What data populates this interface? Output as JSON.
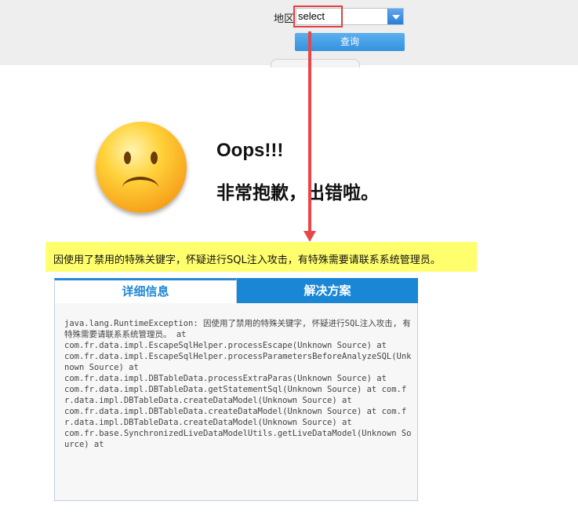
{
  "header": {
    "region_label": "地区",
    "region_select_value": "select",
    "query_button_label": "查询"
  },
  "error": {
    "title": "Oops!!!",
    "subtitle": "非常抱歉，出错啦。",
    "warning": "因使用了禁用的特殊关键字，怀疑进行SQL注入攻击，有特殊需要请联系系统管理员。"
  },
  "tabs": [
    {
      "label": "详细信息"
    },
    {
      "label": "解决方案"
    }
  ],
  "details": {
    "text": "java.lang.RuntimeException: 因使用了禁用的特殊关键字, 怀疑进行SQL注入攻击, 有特殊需要请联系系统管理员。 at\ncom.fr.data.impl.EscapeSqlHelper.processEscape(Unknown Source) at\ncom.fr.data.impl.EscapeSqlHelper.processParametersBeforeAnalyzeSQL(Unknown Source) at\ncom.fr.data.impl.DBTableData.processExtraParas(Unknown Source) at\ncom.fr.data.impl.DBTableData.getStatementSql(Unknown Source) at com.fr.data.impl.DBTableData.createDataModel(Unknown Source) at\ncom.fr.data.impl.DBTableData.createDataModel(Unknown Source) at com.fr.data.impl.DBTableData.createDataModel(Unknown Source) at\ncom.fr.base.SynchronizedLiveDataModelUtils.getLiveDataModel(Unknown Source) at"
  },
  "colors": {
    "annotation_red": "#e8474a",
    "tab_blue": "#1a86d6",
    "warning_yellow": "#ffff6e"
  }
}
